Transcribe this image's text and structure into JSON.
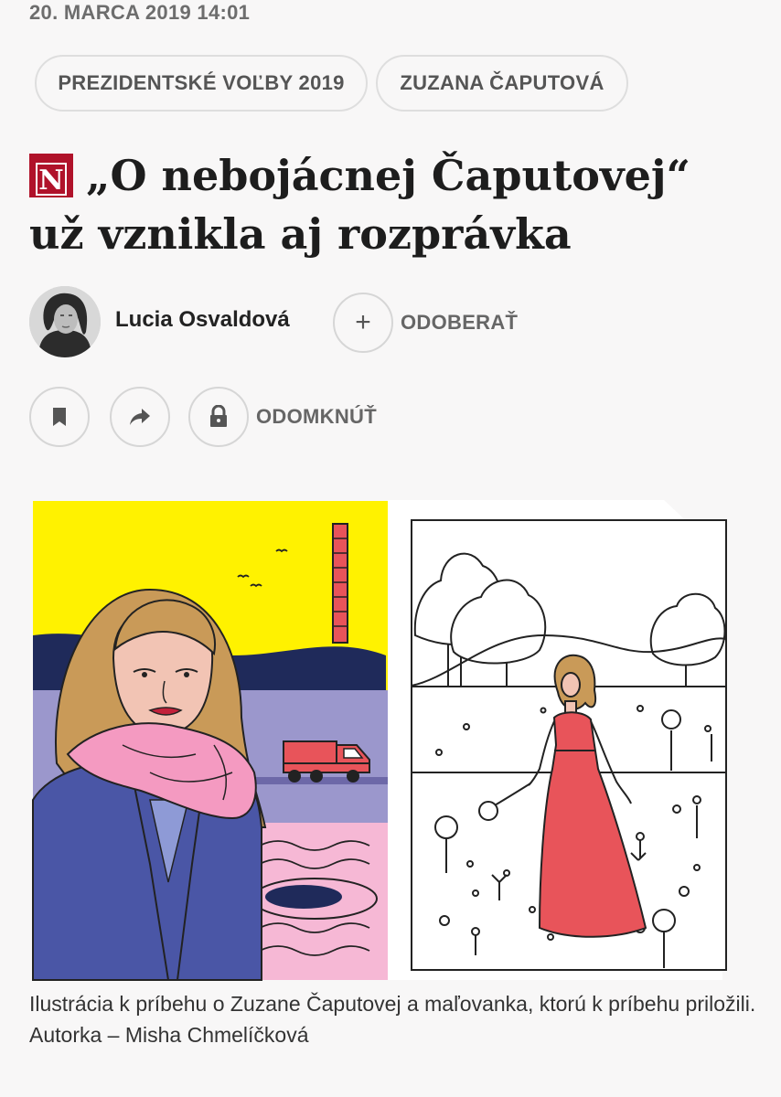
{
  "article": {
    "date": "20. MARCA 2019 14:01",
    "tags": [
      "PREZIDENTSKÉ VOĽBY 2019",
      "ZUZANA ČAPUTOVÁ"
    ],
    "logo_letter": "N",
    "title_line1": "„O nebojácnej Čaputovej“",
    "title_line2": "už vznikla aj rozprávka",
    "author": "Lucia Osvaldová",
    "follow_symbol": "+",
    "follow_label": "ODOBERAŤ",
    "unlock_label": "ODOMKNÚŤ",
    "caption": "Ilustrácia k príbehu o Zuzane Čaputovej a maľovanka, ktorú k príbehu priložili. Autorka – Misha Chmelíčková"
  },
  "icons": [
    "bookmark-icon",
    "share-icon",
    "lock-icon",
    "plus-icon"
  ],
  "colors": {
    "logo_red": "#b0122a",
    "sky_yellow": "#fff200",
    "dress_red": "#e8545a",
    "scarf_pink": "#f49ac1",
    "coat_blue": "#4a56a6"
  }
}
